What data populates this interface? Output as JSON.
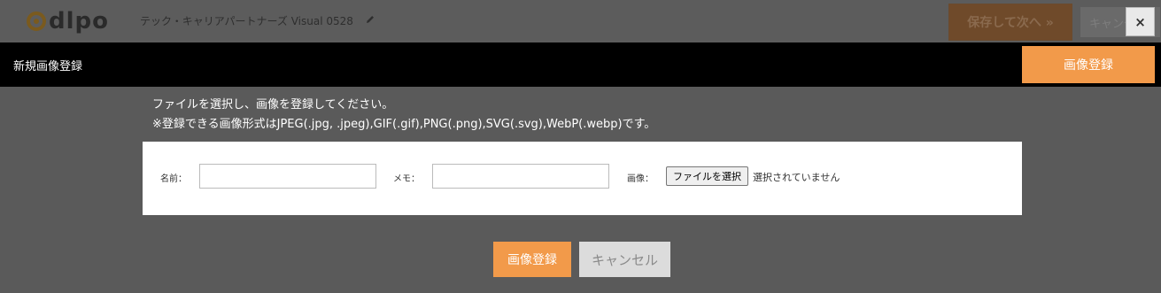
{
  "app": {
    "logo_text": "dlpo",
    "project_title": "テック・キャリアパートナーズ Visual 0528",
    "save_next_label": "保存して次へ »",
    "cancel_label": "キャンセル",
    "close_label": "×"
  },
  "modal": {
    "title": "新規画像登録",
    "register_label": "画像登録",
    "instructions": [
      "ファイルを選択し、画像を登録してください。",
      "※登録できる画像形式はJPEG(.jpg, .jpeg),GIF(.gif),PNG(.png),SVG(.svg),WebP(.webp)です。"
    ],
    "form": {
      "name_label": "名前：",
      "name_value": "",
      "memo_label": "メモ：",
      "memo_value": "",
      "image_label": "画像：",
      "file_button_label": "ファイルを選択",
      "file_status": "選択されていません"
    },
    "footer": {
      "register_label": "画像登録",
      "cancel_label": "キャンセル"
    }
  },
  "colors": {
    "accent": "#f29a4a",
    "overlay": "#5a5a5a",
    "title_bar": "#000000"
  }
}
